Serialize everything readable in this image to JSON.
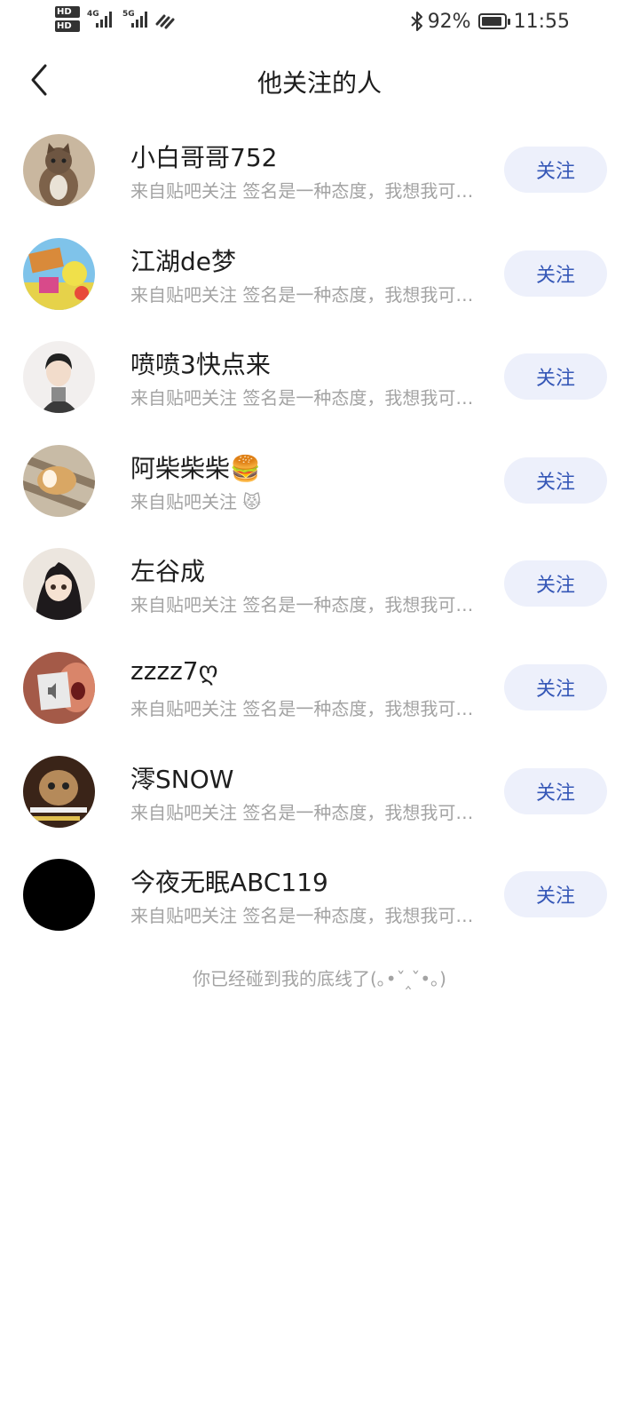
{
  "status_bar": {
    "hd1": "HD",
    "hd2": "HD",
    "network1": "4G",
    "network2": "5G",
    "battery_percent": "92%",
    "time": "11:55"
  },
  "header": {
    "title": "他关注的人"
  },
  "follow_button_label": "关注",
  "users": [
    {
      "name": "小白哥哥752",
      "subtitle": "来自贴吧关注 签名是一种态度，我想我可以更酷"
    },
    {
      "name": "江湖de梦",
      "subtitle": "来自贴吧关注 签名是一种态度，我想我可以更酷"
    },
    {
      "name": "喷喷3快点来",
      "subtitle": "来自贴吧关注 签名是一种态度，我想我可以更酷"
    },
    {
      "name": "阿柴柴柴🍔",
      "subtitle": "来自贴吧关注 😾"
    },
    {
      "name": "左谷成",
      "subtitle": "来自贴吧关注 签名是一种态度，我想我可以更酷"
    },
    {
      "name": "zzzz7ღ",
      "subtitle": "来自贴吧关注 签名是一种态度，我想我可以更酷"
    },
    {
      "name": "澪SNOW",
      "subtitle": "来自贴吧关注 签名是一种态度，我想我可以更酷"
    },
    {
      "name": "今夜无眠ABC119",
      "subtitle": "来自贴吧关注 签名是一种态度，我想我可以更酷"
    }
  ],
  "avatar_colors": [
    "#8a6a4c",
    "#4aa0d8",
    "#e8e4e2",
    "#b6a58f",
    "#3c3a3c",
    "#b86a58",
    "#6a4a36",
    "#000000"
  ],
  "bottom_note": "你已经碰到我的底线了(｡•ˇ‸ˇ•｡)"
}
